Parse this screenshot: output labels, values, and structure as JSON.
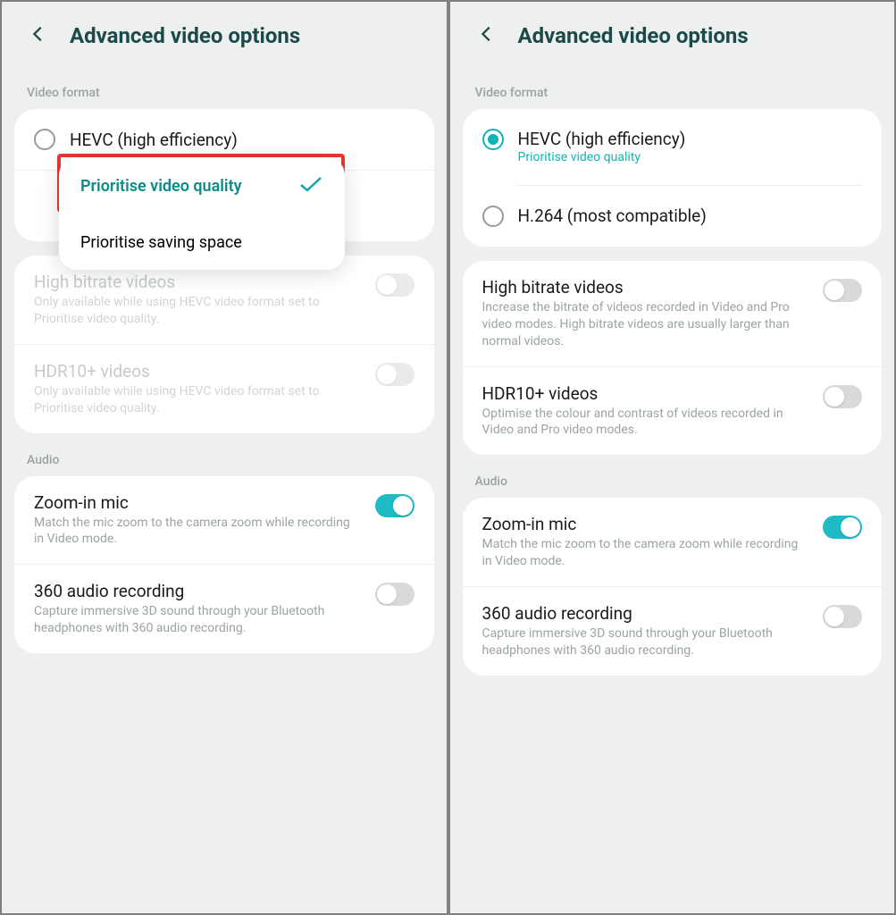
{
  "left": {
    "title": "Advanced video options",
    "section_video": "Video format",
    "radio_hevc": "HEVC (high efficiency)",
    "popup_option_quality": "Prioritise video quality",
    "popup_option_space": "Prioritise saving space",
    "high_bitrate_title": "High bitrate videos",
    "high_bitrate_sub": "Only available while using HEVC video format set to Prioritise video quality.",
    "hdr_title": "HDR10+ videos",
    "hdr_sub": "Only available while using HEVC video format set to Prioritise video quality.",
    "section_audio": "Audio",
    "zoom_title": "Zoom-in mic",
    "zoom_sub": "Match the mic zoom to the camera zoom while recording in Video mode.",
    "audio360_title": "360 audio recording",
    "audio360_sub": "Capture immersive 3D sound through your Bluetooth headphones with 360 audio recording."
  },
  "right": {
    "title": "Advanced video options",
    "section_video": "Video format",
    "radio_hevc": "HEVC (high efficiency)",
    "radio_hevc_sub": "Prioritise video quality",
    "radio_h264": "H.264 (most compatible)",
    "high_bitrate_title": "High bitrate videos",
    "high_bitrate_sub": "Increase the bitrate of videos recorded in Video and Pro video modes. High bitrate videos are usually larger than normal videos.",
    "hdr_title": "HDR10+ videos",
    "hdr_sub": "Optimise the colour and contrast of videos recorded in Video and Pro video modes.",
    "section_audio": "Audio",
    "zoom_title": "Zoom-in mic",
    "zoom_sub": "Match the mic zoom to the camera zoom while recording in Video mode.",
    "audio360_title": "360 audio recording",
    "audio360_sub": "Capture immersive 3D sound through your Bluetooth headphones with 360 audio recording."
  }
}
